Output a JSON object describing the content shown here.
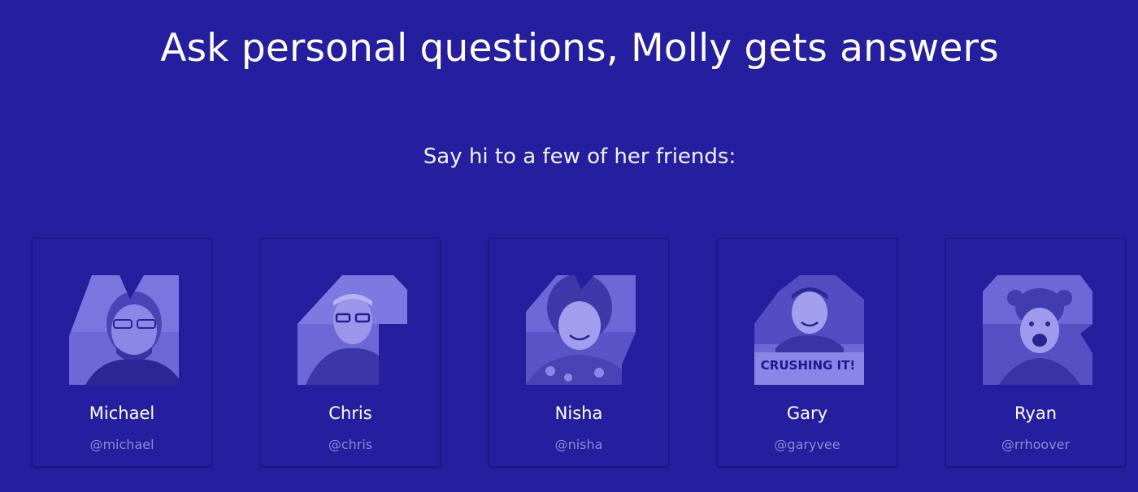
{
  "page": {
    "headline": "Ask personal questions, Molly gets answers",
    "subheadline": "Say hi to a few of her friends:"
  },
  "friends": [
    {
      "name": "Michael",
      "handle": "@michael",
      "avatar_icon": "michael-portrait-icon"
    },
    {
      "name": "Chris",
      "handle": "@chris",
      "avatar_icon": "chris-portrait-icon"
    },
    {
      "name": "Nisha",
      "handle": "@nisha",
      "avatar_icon": "nisha-portrait-icon"
    },
    {
      "name": "Gary",
      "handle": "@garyvee",
      "avatar_icon": "gary-portrait-icon",
      "avatar_caption": "CRUSHING IT!"
    },
    {
      "name": "Ryan",
      "handle": "@rrhoover",
      "avatar_icon": "ryan-portrait-icon"
    }
  ],
  "colors": {
    "background": "#251e9e",
    "card_border": "#1b1580",
    "avatar_tint": "#6d67d8",
    "handle_text": "#8d88d9"
  }
}
